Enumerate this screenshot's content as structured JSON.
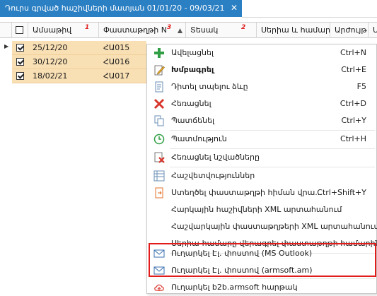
{
  "window": {
    "title": "Դուրս գրված հաշիվների մատյան 01/01/20 - 09/03/21",
    "close_glyph": "✕"
  },
  "columns": [
    {
      "label": "Ամսաթիվ",
      "num": "1"
    },
    {
      "label": "Փաստաթղթի N",
      "num": "3"
    },
    {
      "label": "Տեսակ",
      "num": "2"
    },
    {
      "label": "Սերիա և համար"
    },
    {
      "label": "Արժույթ"
    },
    {
      "label": "Ստ"
    }
  ],
  "rows": [
    {
      "date": "25/12/20",
      "doc": "ՀԱ015",
      "checked": true,
      "current": true
    },
    {
      "date": "30/12/20",
      "doc": "ՀԱ016",
      "checked": true
    },
    {
      "date": "18/02/21",
      "doc": "ՀԱ017",
      "checked": true
    }
  ],
  "menu": {
    "items": [
      {
        "label": "Ավելացնել",
        "shortcut": "Ctrl+N",
        "icon": "plus-icon"
      },
      {
        "label": "Խմբագրել",
        "shortcut": "Ctrl+E",
        "icon": "edit-icon",
        "bold": true
      },
      {
        "label": "Դիտել տպելու ձևը",
        "shortcut": "F5",
        "icon": "print-preview-icon"
      },
      {
        "label": "Հեռացնել",
        "shortcut": "Ctrl+D",
        "icon": "delete-icon"
      },
      {
        "label": "Պատճենել",
        "shortcut": "Ctrl+Y",
        "icon": "copy-icon"
      },
      {
        "label": "Պատմություն",
        "shortcut": "Ctrl+H",
        "icon": "history-icon"
      },
      {
        "label": "Հեռացնել նշվածները",
        "shortcut": "",
        "icon": "delete-selected-icon"
      },
      {
        "label": "Հաշվետվություններ",
        "shortcut": "",
        "icon": "reports-icon"
      },
      {
        "label": "Ստեղծել փաստաթղթի հիման վրա...",
        "shortcut": "Ctrl+Shift+Y",
        "icon": "create-based-icon"
      },
      {
        "label": "Հարկային հաշիվների XML արտահանում",
        "shortcut": "",
        "icon": ""
      },
      {
        "label": "Հաշվարկային փաստաթղթերի XML արտահանում",
        "shortcut": "",
        "icon": ""
      },
      {
        "label": "Սերիա-համարը վերագրել փաստաթղթի համարին",
        "shortcut": "",
        "icon": ""
      },
      {
        "label": "Ուղարկել Էլ. փոստով (MS Outlook)",
        "shortcut": "",
        "icon": "email-outlook-icon"
      },
      {
        "label": "Ուղարկել Էլ. փոստով (armsoft.am)",
        "shortcut": "",
        "icon": "email-armsoft-icon"
      },
      {
        "label": "Ուղարկել b2b.armsoft հարթակ",
        "shortcut": "",
        "icon": "cloud-upload-icon"
      }
    ]
  },
  "colors": {
    "accent": "#2b7fc3",
    "row_selected": "#f8dfb4",
    "highlight": "#e21b1b"
  }
}
